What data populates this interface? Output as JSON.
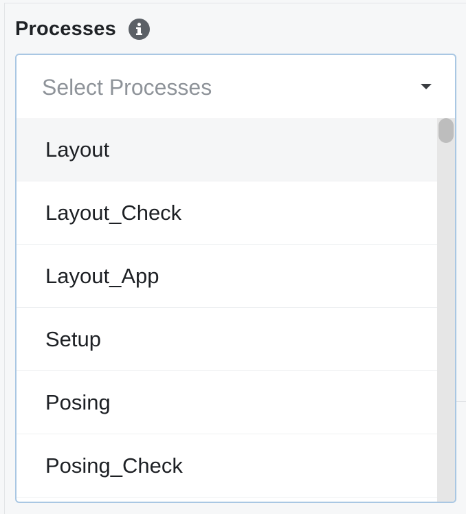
{
  "field": {
    "label": "Processes",
    "info_icon": "info-circle-icon",
    "placeholder": "Select Processes",
    "caret_icon": "caret-down-icon"
  },
  "options": [
    {
      "label": "Layout",
      "highlighted": true
    },
    {
      "label": "Layout_Check",
      "highlighted": false
    },
    {
      "label": "Layout_App",
      "highlighted": false
    },
    {
      "label": "Setup",
      "highlighted": false
    },
    {
      "label": "Posing",
      "highlighted": false
    },
    {
      "label": "Posing_Check",
      "highlighted": false
    }
  ],
  "colors": {
    "focus_border": "#a9c7e3",
    "highlight_bg": "#f5f6f7",
    "placeholder": "#8e9399",
    "label": "#1f2226",
    "info_icon": "#5b6066"
  }
}
